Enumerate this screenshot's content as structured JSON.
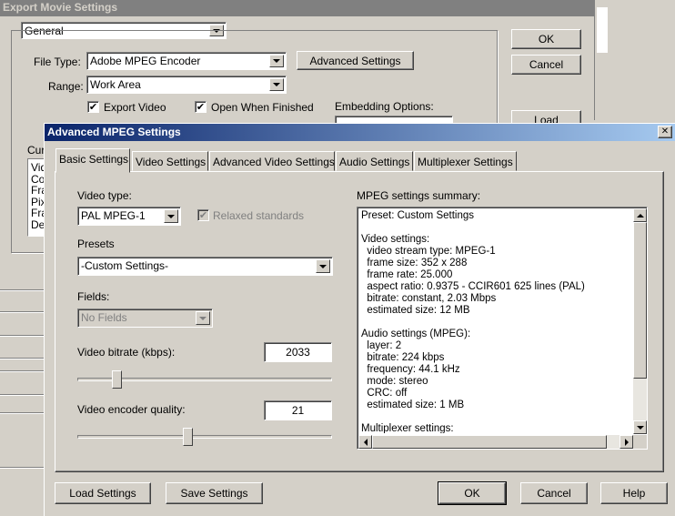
{
  "export_window": {
    "title": "Export Movie Settings",
    "section_select": "General",
    "file_type_label": "File Type:",
    "file_type_value": "Adobe MPEG Encoder",
    "advanced_settings_button": "Advanced Settings",
    "range_label": "Range:",
    "range_value": "Work Area",
    "export_video_label": "Export Video",
    "open_when_finished_label": "Open When Finished",
    "embedding_options_label": "Embedding Options:",
    "ok_button": "OK",
    "cancel_button": "Cancel",
    "load_button": "Load",
    "current_settings_label": "Cur",
    "current_list": [
      "Vid",
      "Co",
      "Fra",
      "Pix",
      "Fra",
      "De"
    ]
  },
  "dialog": {
    "title": "Advanced MPEG Settings",
    "close_glyph": "✕",
    "tabs": [
      "Basic Settings",
      "Video Settings",
      "Advanced Video Settings",
      "Audio Settings",
      "Multiplexer Settings"
    ],
    "active_tab": "Basic Settings",
    "video_type_label": "Video type:",
    "video_type_value": "PAL MPEG-1",
    "relaxed_standards_label": "Relaxed standards",
    "presets_label": "Presets",
    "presets_value": "-Custom Settings-",
    "fields_label": "Fields:",
    "fields_value": "No Fields",
    "video_bitrate_label": "Video bitrate (kbps):",
    "video_bitrate_value": "2033",
    "video_bitrate_slider_fraction": 0.14,
    "encoder_quality_label": "Video encoder quality:",
    "encoder_quality_value": "21",
    "encoder_quality_slider_fraction": 0.43,
    "summary_label": "MPEG settings summary:",
    "summary_lines": [
      "Preset: Custom Settings",
      "",
      "Video settings:",
      "  video stream type: MPEG-1",
      "  frame size: 352 x 288",
      "  frame rate: 25.000",
      "  aspect ratio: 0.9375 - CCIR601 625 lines (PAL)",
      "  bitrate: constant, 2.03 Mbps",
      "  estimated size: 12 MB",
      "",
      "Audio settings (MPEG):",
      "  layer: 2",
      "  bitrate: 224 kbps",
      "  frequency: 44.1 kHz",
      "  mode: stereo",
      "  CRC: off",
      "  estimated size: 1 MB",
      "",
      "Multiplexer settings:"
    ],
    "load_settings_button": "Load Settings",
    "save_settings_button": "Save Settings",
    "ok_button": "OK",
    "cancel_button": "Cancel",
    "help_button": "Help"
  }
}
